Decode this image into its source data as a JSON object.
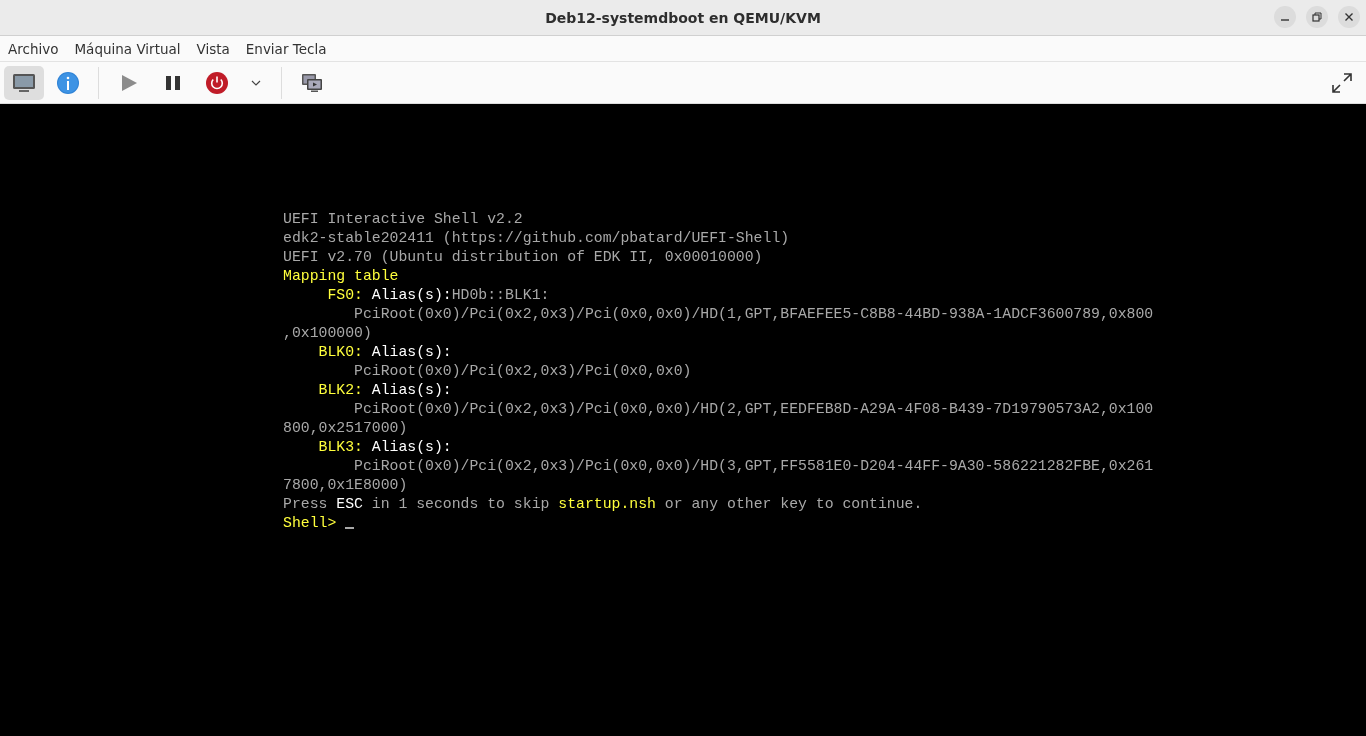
{
  "window": {
    "title": "Deb12-systemdboot en QEMU/KVM"
  },
  "menu": [
    "Archivo",
    "Máquina Virtual",
    "Vista",
    "Enviar Tecla"
  ],
  "toolbar": [
    {
      "kind": "console",
      "selected": true
    },
    {
      "kind": "details",
      "selected": false
    },
    {
      "kind": "separator"
    },
    {
      "kind": "run",
      "selected": false
    },
    {
      "kind": "pause",
      "selected": false
    },
    {
      "kind": "power",
      "selected": false
    },
    {
      "kind": "dropdown",
      "selected": false
    },
    {
      "kind": "separator"
    },
    {
      "kind": "snapshots",
      "selected": false
    }
  ],
  "console": {
    "lines": [
      [
        {
          "text": "UEFI Interactive Shell v2.2",
          "kind": "plain"
        }
      ],
      [
        {
          "text": "edk2-stable202411 (https://github.com/pbatard/UEFI-Shell)",
          "kind": "plain"
        }
      ],
      [
        {
          "text": "UEFI v2.70 (Ubuntu distribution of EDK II, 0x00010000)",
          "kind": "plain"
        }
      ],
      [
        {
          "text": "Mapping table",
          "kind": "highlight"
        }
      ],
      [
        {
          "text": "     FS0:",
          "kind": "highlight"
        },
        {
          "text": " Alias(s):",
          "kind": "bright"
        },
        {
          "text": "HD0b::BLK1:",
          "kind": "plain"
        }
      ],
      [
        {
          "text": "        PciRoot(0x0)/Pci(0x2,0x3)/Pci(0x0,0x0)/HD(1,GPT,BFAEFEE5-C8B8-44BD-938A-1ADCF3600789,0x800",
          "kind": "plain"
        }
      ],
      [
        {
          "text": ",0x100000)",
          "kind": "plain"
        }
      ],
      [
        {
          "text": "    BLK0:",
          "kind": "highlight"
        },
        {
          "text": " Alias(s):",
          "kind": "bright"
        }
      ],
      [
        {
          "text": "        PciRoot(0x0)/Pci(0x2,0x3)/Pci(0x0,0x0)",
          "kind": "plain"
        }
      ],
      [
        {
          "text": "    BLK2:",
          "kind": "highlight"
        },
        {
          "text": " Alias(s):",
          "kind": "bright"
        }
      ],
      [
        {
          "text": "        PciRoot(0x0)/Pci(0x2,0x3)/Pci(0x0,0x0)/HD(2,GPT,EEDFEB8D-A29A-4F08-B439-7D19790573A2,0x100",
          "kind": "plain"
        }
      ],
      [
        {
          "text": "800,0x2517000)",
          "kind": "plain"
        }
      ],
      [
        {
          "text": "    BLK3:",
          "kind": "highlight"
        },
        {
          "text": " Alias(s):",
          "kind": "bright"
        }
      ],
      [
        {
          "text": "        PciRoot(0x0)/Pci(0x2,0x3)/Pci(0x0,0x0)/HD(3,GPT,FF5581E0-D204-44FF-9A30-586221282FBE,0x261",
          "kind": "plain"
        }
      ],
      [
        {
          "text": "7800,0x1E8000)",
          "kind": "plain"
        }
      ],
      [
        {
          "text": "Press ",
          "kind": "plain"
        },
        {
          "text": "ESC",
          "kind": "bright"
        },
        {
          "text": " in 1 seconds to skip ",
          "kind": "plain"
        },
        {
          "text": "startup.nsh",
          "kind": "highlight"
        },
        {
          "text": " or any other key to continue.",
          "kind": "plain"
        }
      ],
      [
        {
          "text": "Shell> ",
          "kind": "highlight"
        }
      ]
    ],
    "cursor": true
  }
}
